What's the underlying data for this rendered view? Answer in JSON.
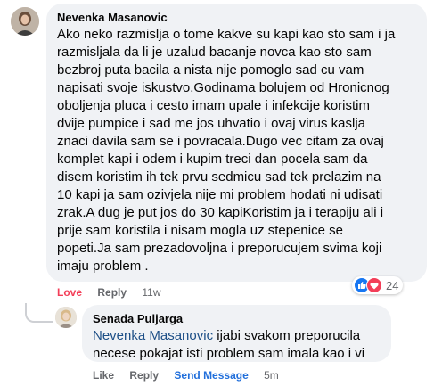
{
  "comment": {
    "author": "Nevenka Masanovic",
    "text": "Ako neko razmislja o tome kakve su kapi kao sto sam i ja\nrazmisljala da li je uzalud bacanje novca kao sto sam\nbezbroj puta bacila a nista nije pomoglo sad cu vam\nnapisati svoje iskustvo.Godinama bolujem od Hronicnog\noboljenja pluca i cesto imam upale i infekcije koristim\ndvije pumpice i sad me jos uhvatio i ovaj virus kaslja\nznaci davila sam se i povracala.Dugo vec citam za ovaj\nkomplet kapi i odem i kupim treci dan pocela sam da\ndisem koristim ih tek prvu sedmicu sad tek prelazim na\n10 kapi ja sam ozivjela nije mi problem hodati ni udisati\nzrak.A dug je put jos do 30 kapiKoristim ja i terapiju ali i\nprije sam koristila i nisam mogla uz stepenice se\npopeti.Ja sam prezadovoljna i preporucujem svima koji\nimaju problem .",
    "actions": {
      "love": "Love",
      "reply": "Reply",
      "time": "11w"
    },
    "reactions": {
      "count": "24",
      "icons": [
        "like-icon",
        "love-icon"
      ]
    }
  },
  "reply": {
    "author": "Senada Puljarga",
    "mention": "Nevenka Masanovic",
    "text": " ijabi svakom preporucila\nnecese pokajat isti problem sam imala kao i vi",
    "actions": {
      "like": "Like",
      "reply": "Reply",
      "send_message": "Send Message",
      "time": "5m"
    }
  },
  "colors": {
    "bubble": "#f0f2f5",
    "like_blue": "#1877f2",
    "love_red": "#f33e58",
    "mention": "#1c4e86",
    "send_message": "#216fdb"
  }
}
